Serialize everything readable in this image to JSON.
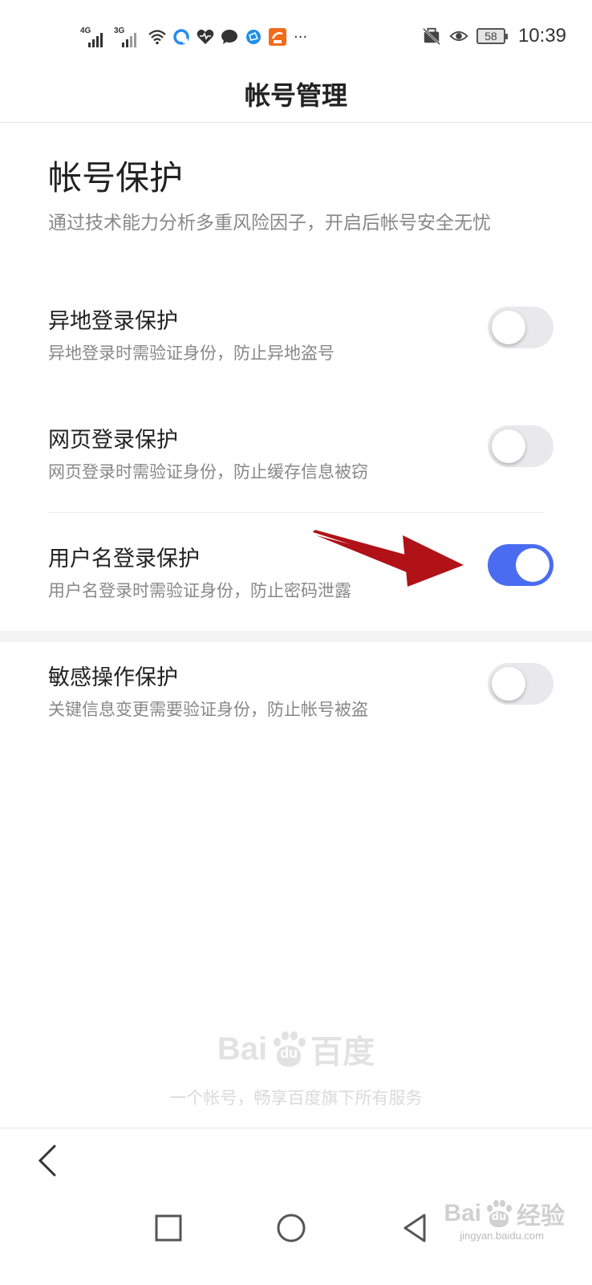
{
  "status_bar": {
    "network_1": "4G",
    "network_2": "3G",
    "battery": "58",
    "time": "10:39",
    "more": "···",
    "icons": [
      "signal-icon",
      "wifi-icon",
      "browser-icon",
      "health-icon",
      "chat-icon",
      "network-icon",
      "app-icon",
      "mute-icon",
      "eye-icon",
      "battery-icon"
    ]
  },
  "header": {
    "title": "帐号管理"
  },
  "section": {
    "title": "帐号保护",
    "desc": "通过技术能力分析多重风险因子，开启后帐号安全无忧"
  },
  "settings": [
    {
      "label": "异地登录保护",
      "desc": "异地登录时需验证身份，防止异地盗号",
      "enabled": false
    },
    {
      "label": "网页登录保护",
      "desc": "网页登录时需验证身份，防止缓存信息被窃",
      "enabled": false
    },
    {
      "label": "用户名登录保护",
      "desc": "用户名登录时需验证身份，防止密码泄露",
      "enabled": true
    },
    {
      "label": "敏感操作保护",
      "desc": "关键信息变更需要验证身份，防止帐号被盗",
      "enabled": false
    }
  ],
  "colors": {
    "accent": "#4a6cf0",
    "arrow": "#b01218"
  },
  "footer": {
    "brand_left": "Bai",
    "brand_du": "du",
    "brand_cn": "百度",
    "slogan": "一个帐号，畅享百度旗下所有服务"
  },
  "watermark": {
    "text_left": "Bai",
    "text_du": "du",
    "text_cn": "经验",
    "url": "jingyan.baidu.com"
  }
}
